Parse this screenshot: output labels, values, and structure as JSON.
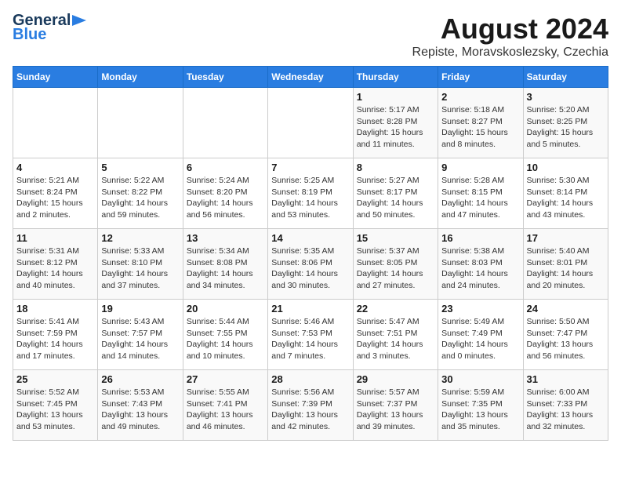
{
  "header": {
    "logo_line1": "General",
    "logo_line2": "Blue",
    "title": "August 2024",
    "subtitle": "Repiste, Moravskoslezsky, Czechia"
  },
  "days_of_week": [
    "Sunday",
    "Monday",
    "Tuesday",
    "Wednesday",
    "Thursday",
    "Friday",
    "Saturday"
  ],
  "weeks": [
    [
      {
        "day": "",
        "info": ""
      },
      {
        "day": "",
        "info": ""
      },
      {
        "day": "",
        "info": ""
      },
      {
        "day": "",
        "info": ""
      },
      {
        "day": "1",
        "info": "Sunrise: 5:17 AM\nSunset: 8:28 PM\nDaylight: 15 hours\nand 11 minutes."
      },
      {
        "day": "2",
        "info": "Sunrise: 5:18 AM\nSunset: 8:27 PM\nDaylight: 15 hours\nand 8 minutes."
      },
      {
        "day": "3",
        "info": "Sunrise: 5:20 AM\nSunset: 8:25 PM\nDaylight: 15 hours\nand 5 minutes."
      }
    ],
    [
      {
        "day": "4",
        "info": "Sunrise: 5:21 AM\nSunset: 8:24 PM\nDaylight: 15 hours\nand 2 minutes."
      },
      {
        "day": "5",
        "info": "Sunrise: 5:22 AM\nSunset: 8:22 PM\nDaylight: 14 hours\nand 59 minutes."
      },
      {
        "day": "6",
        "info": "Sunrise: 5:24 AM\nSunset: 8:20 PM\nDaylight: 14 hours\nand 56 minutes."
      },
      {
        "day": "7",
        "info": "Sunrise: 5:25 AM\nSunset: 8:19 PM\nDaylight: 14 hours\nand 53 minutes."
      },
      {
        "day": "8",
        "info": "Sunrise: 5:27 AM\nSunset: 8:17 PM\nDaylight: 14 hours\nand 50 minutes."
      },
      {
        "day": "9",
        "info": "Sunrise: 5:28 AM\nSunset: 8:15 PM\nDaylight: 14 hours\nand 47 minutes."
      },
      {
        "day": "10",
        "info": "Sunrise: 5:30 AM\nSunset: 8:14 PM\nDaylight: 14 hours\nand 43 minutes."
      }
    ],
    [
      {
        "day": "11",
        "info": "Sunrise: 5:31 AM\nSunset: 8:12 PM\nDaylight: 14 hours\nand 40 minutes."
      },
      {
        "day": "12",
        "info": "Sunrise: 5:33 AM\nSunset: 8:10 PM\nDaylight: 14 hours\nand 37 minutes."
      },
      {
        "day": "13",
        "info": "Sunrise: 5:34 AM\nSunset: 8:08 PM\nDaylight: 14 hours\nand 34 minutes."
      },
      {
        "day": "14",
        "info": "Sunrise: 5:35 AM\nSunset: 8:06 PM\nDaylight: 14 hours\nand 30 minutes."
      },
      {
        "day": "15",
        "info": "Sunrise: 5:37 AM\nSunset: 8:05 PM\nDaylight: 14 hours\nand 27 minutes."
      },
      {
        "day": "16",
        "info": "Sunrise: 5:38 AM\nSunset: 8:03 PM\nDaylight: 14 hours\nand 24 minutes."
      },
      {
        "day": "17",
        "info": "Sunrise: 5:40 AM\nSunset: 8:01 PM\nDaylight: 14 hours\nand 20 minutes."
      }
    ],
    [
      {
        "day": "18",
        "info": "Sunrise: 5:41 AM\nSunset: 7:59 PM\nDaylight: 14 hours\nand 17 minutes."
      },
      {
        "day": "19",
        "info": "Sunrise: 5:43 AM\nSunset: 7:57 PM\nDaylight: 14 hours\nand 14 minutes."
      },
      {
        "day": "20",
        "info": "Sunrise: 5:44 AM\nSunset: 7:55 PM\nDaylight: 14 hours\nand 10 minutes."
      },
      {
        "day": "21",
        "info": "Sunrise: 5:46 AM\nSunset: 7:53 PM\nDaylight: 14 hours\nand 7 minutes."
      },
      {
        "day": "22",
        "info": "Sunrise: 5:47 AM\nSunset: 7:51 PM\nDaylight: 14 hours\nand 3 minutes."
      },
      {
        "day": "23",
        "info": "Sunrise: 5:49 AM\nSunset: 7:49 PM\nDaylight: 14 hours\nand 0 minutes."
      },
      {
        "day": "24",
        "info": "Sunrise: 5:50 AM\nSunset: 7:47 PM\nDaylight: 13 hours\nand 56 minutes."
      }
    ],
    [
      {
        "day": "25",
        "info": "Sunrise: 5:52 AM\nSunset: 7:45 PM\nDaylight: 13 hours\nand 53 minutes."
      },
      {
        "day": "26",
        "info": "Sunrise: 5:53 AM\nSunset: 7:43 PM\nDaylight: 13 hours\nand 49 minutes."
      },
      {
        "day": "27",
        "info": "Sunrise: 5:55 AM\nSunset: 7:41 PM\nDaylight: 13 hours\nand 46 minutes."
      },
      {
        "day": "28",
        "info": "Sunrise: 5:56 AM\nSunset: 7:39 PM\nDaylight: 13 hours\nand 42 minutes."
      },
      {
        "day": "29",
        "info": "Sunrise: 5:57 AM\nSunset: 7:37 PM\nDaylight: 13 hours\nand 39 minutes."
      },
      {
        "day": "30",
        "info": "Sunrise: 5:59 AM\nSunset: 7:35 PM\nDaylight: 13 hours\nand 35 minutes."
      },
      {
        "day": "31",
        "info": "Sunrise: 6:00 AM\nSunset: 7:33 PM\nDaylight: 13 hours\nand 32 minutes."
      }
    ]
  ]
}
